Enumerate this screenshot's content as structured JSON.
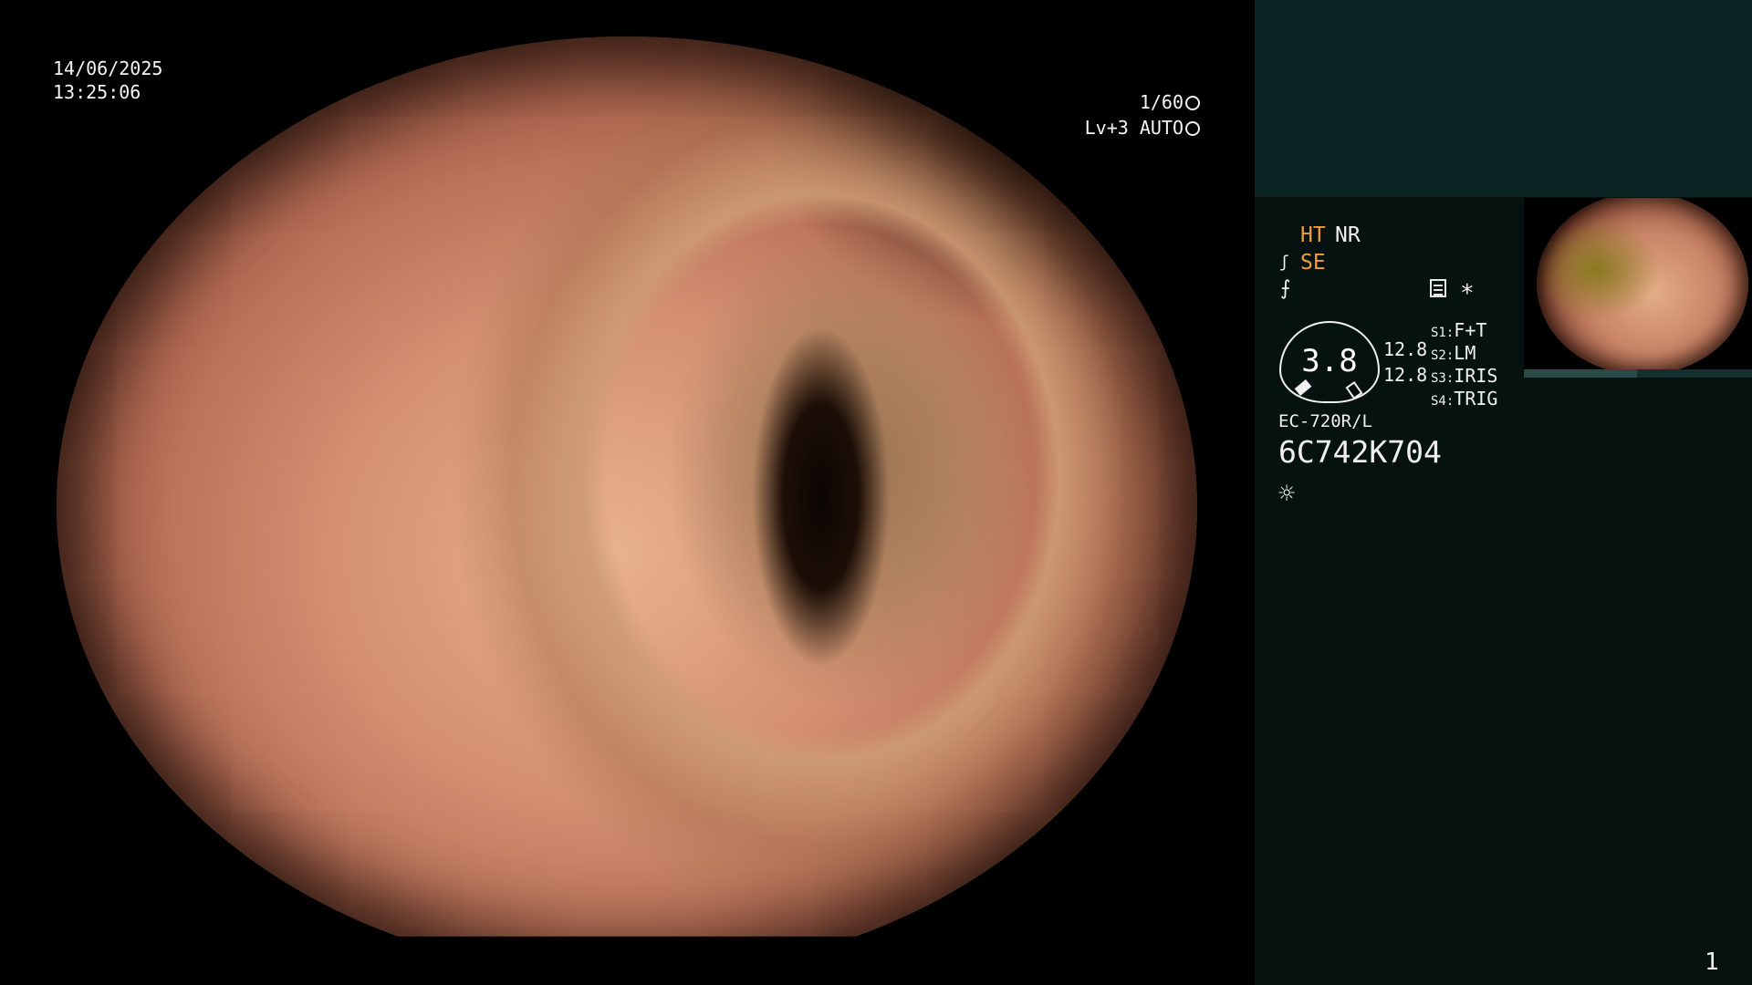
{
  "overlay": {
    "date": "14/06/2025",
    "time": "13:25:06",
    "shutter": "1/60",
    "level": "Lv+3 AUTO"
  },
  "panel": {
    "ht": "HT",
    "nr": "NR",
    "se": "SE",
    "gauge_value": "3.8",
    "zoom_values": [
      "12.8",
      "12.8"
    ],
    "switches": [
      {
        "key": "S1:",
        "value": "F+T"
      },
      {
        "key": "S2:",
        "value": "LM"
      },
      {
        "key": "S3:",
        "value": "IRIS"
      },
      {
        "key": "S4:",
        "value": "TRIG"
      }
    ],
    "scope_model": "EC-720R/L",
    "scope_serial": "6C742K704"
  },
  "icons": {
    "se": "ʃ",
    "filter": "⨍",
    "asterisk": "*",
    "light": "☼"
  },
  "colors": {
    "accent": "#f0a030",
    "panel_bg": "#061210",
    "panel_top_bg": "#0d2424"
  },
  "page_number": "1"
}
